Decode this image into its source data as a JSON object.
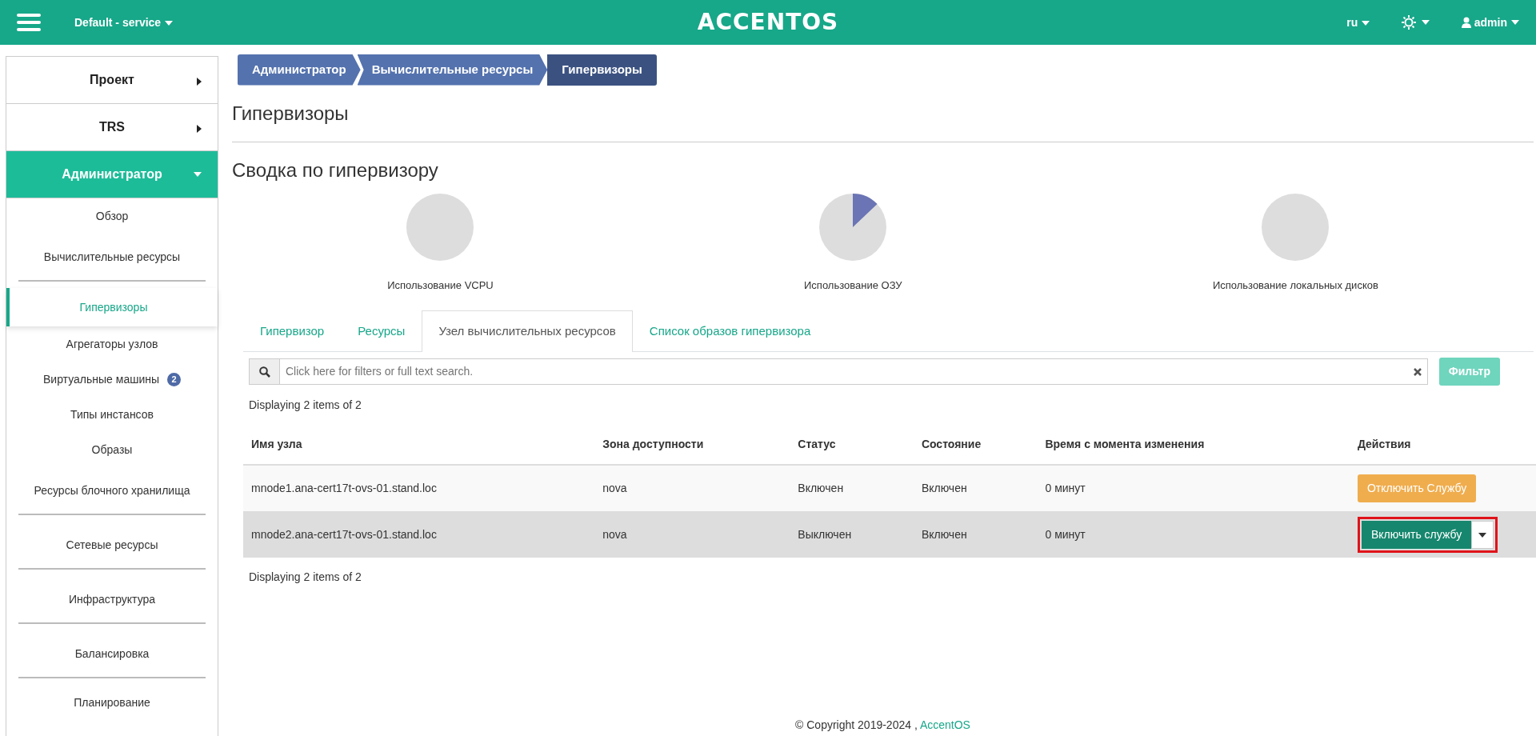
{
  "topbar": {
    "project": "Default - service",
    "logo": "ACCENTOS",
    "language": "ru",
    "user": "admin"
  },
  "sidebar": {
    "items": [
      {
        "kind": "section",
        "label": "Проект",
        "expanded": false
      },
      {
        "kind": "section",
        "label": "TRS",
        "expanded": false
      },
      {
        "kind": "section",
        "label": "Администратор",
        "expanded": true
      },
      {
        "kind": "item",
        "label": "Обзор",
        "selected": false
      },
      {
        "kind": "group",
        "label": "Вычислительные ресурсы"
      },
      {
        "kind": "item",
        "label": "Гипервизоры",
        "selected": true
      },
      {
        "kind": "item",
        "label": "Агрегаторы узлов",
        "selected": false
      },
      {
        "kind": "item",
        "label": "Виртуальные машины",
        "selected": false,
        "badge": "2"
      },
      {
        "kind": "item",
        "label": "Типы инстансов",
        "selected": false
      },
      {
        "kind": "item",
        "label": "Образы",
        "selected": false
      },
      {
        "kind": "group",
        "label": "Ресурсы блочного хранилища"
      },
      {
        "kind": "group",
        "label": "Сетевые ресурсы"
      },
      {
        "kind": "group",
        "label": "Инфраструктура"
      },
      {
        "kind": "group",
        "label": "Балансировка"
      },
      {
        "kind": "item",
        "label": "Планирование",
        "selected": false
      }
    ]
  },
  "breadcrumb": [
    {
      "label": "Администратор",
      "selected": false
    },
    {
      "label": "Вычислительные ресурсы",
      "selected": false
    },
    {
      "label": "Гипервизоры",
      "selected": true
    }
  ],
  "page_title": "Гипервизоры",
  "summary": {
    "title": "Сводка по гипервизору",
    "charts": [
      {
        "label": "Использование VCPU",
        "kind": "empty"
      },
      {
        "label": "Использование ОЗУ",
        "kind": "slice"
      },
      {
        "label": "Использование локальных дисков",
        "kind": "empty"
      }
    ]
  },
  "tabs": [
    {
      "label": "Гипервизор",
      "selected": false
    },
    {
      "label": "Ресурсы",
      "selected": false
    },
    {
      "label": "Узел вычислительных ресурсов",
      "selected": true
    },
    {
      "label": "Список образов гипервизора",
      "selected": false
    }
  ],
  "search": {
    "placeholder": "Click here for filters or full text search.",
    "button": "Фильтр"
  },
  "count_top": "Displaying 2 items of 2",
  "table": {
    "columns": [
      "Имя узла",
      "Зона доступности",
      "Статус",
      "Состояние",
      "Время с момента изменения",
      "Действия"
    ],
    "rows": [
      {
        "cells": [
          "mnode1.ana-cert17t-ovs-01.stand.loc",
          "nova",
          "Включен",
          "Включен",
          "0 минут"
        ],
        "selected": false,
        "action": {
          "label": "Отключить Службу",
          "kind": "warning",
          "outlined": false
        }
      },
      {
        "cells": [
          "mnode2.ana-cert17t-ovs-01.stand.loc",
          "nova",
          "Выключен",
          "Включен",
          "0 минут"
        ],
        "selected": true,
        "action": {
          "label": "Включить службу",
          "kind": "split",
          "outlined": true
        }
      }
    ]
  },
  "count_bottom": "Displaying 2 items of 2",
  "footer": {
    "text": "© Copyright 2019-2024 ,",
    "link": "AccentOS"
  }
}
